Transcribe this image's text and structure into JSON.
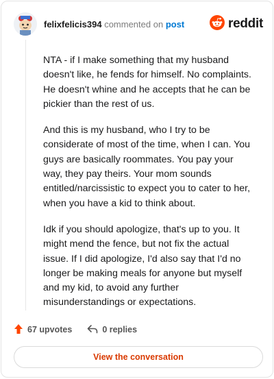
{
  "header": {
    "username": "felixfelicis394",
    "action_text": "commented on",
    "post_link": "post",
    "brand": "reddit"
  },
  "comment": {
    "paragraphs": [
      "NTA - if I make something that my husband doesn't like, he fends for himself. No complaints. He doesn't whine and he accepts that he can be pickier than the rest of us.",
      "And this is my husband, who I try to be considerate of most of the time, when I can. You guys are basically roommates. You pay your way, they pay theirs. Your mom sounds entitled/narcissistic to expect you to cater to her, when you have a kid to think about.",
      "Idk if you should apologize, that's up to you. It might mend the fence, but not fix the actual issue. If I did apologize, I'd also say that I'd no longer be making meals for anyone but myself and my kid, to avoid any further misunderstandings or expectations."
    ]
  },
  "footer": {
    "upvotes": "67 upvotes",
    "replies": "0 replies"
  },
  "cta": {
    "label": "View the conversation"
  },
  "icons": {
    "avatar": "user-avatar",
    "brand": "reddit-logo-icon",
    "upvote": "upvote-arrow-icon",
    "reply": "reply-arrow-icon"
  },
  "colors": {
    "brand_orange": "#ff4500",
    "link_blue": "#0079d3",
    "cta_text": "#d93a00",
    "upvote": "#ff4500"
  }
}
